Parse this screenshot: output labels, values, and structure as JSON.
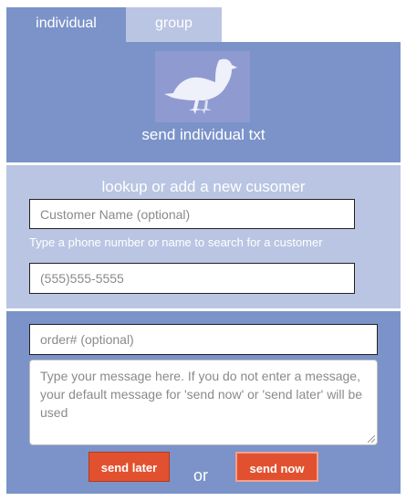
{
  "tabs": [
    {
      "label": "individual",
      "active": true
    },
    {
      "label": "group",
      "active": false
    }
  ],
  "header": {
    "icon": "pigeon-icon",
    "title": "send individual txt"
  },
  "customer": {
    "title": "lookup or add a new cusomer",
    "name_placeholder": "Customer Name (optional)",
    "hint": "Type a phone number or name to search for a customer",
    "phone_placeholder": "(555)555-5555"
  },
  "message": {
    "order_placeholder": "order# (optional)",
    "body_placeholder": "Type your message here. If you do not enter a message, your default message for 'send now' or 'send later' will be used"
  },
  "actions": {
    "send_later_label": "send later",
    "or_label": "or",
    "send_now_label": "send now"
  },
  "colors": {
    "primary_panel": "#7b93c9",
    "light_panel": "#b9c5e2",
    "button": "#e2512f"
  }
}
